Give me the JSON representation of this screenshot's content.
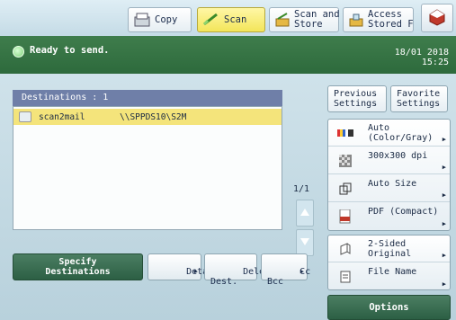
{
  "tabs": [
    {
      "label": "Copy",
      "icon": "copy-icon"
    },
    {
      "label": "Scan",
      "icon": "scan-icon"
    },
    {
      "label": "Scan and\nStore",
      "icon": "scan-store-icon"
    },
    {
      "label": "Access\nStored F",
      "icon": "access-stored-icon"
    }
  ],
  "home_icon": "home-icon",
  "status": {
    "message": "Ready to send.",
    "datetime": "18/01 2018\n15:25"
  },
  "destinations": {
    "header": "Destinations  : 1",
    "rows": [
      {
        "name": "scan2mail",
        "path": "\\\\SPPDS10\\S2M"
      }
    ],
    "page_indicator": "1/1"
  },
  "buttons": {
    "specify": "Specify\nDestinations",
    "details": "Details",
    "delete": "Delete\nDest.",
    "ccbcc": "Cc\nBcc"
  },
  "right": {
    "previous": "Previous\nSettings",
    "favorite": "Favorite\nSettings",
    "settings": [
      {
        "label": "Auto\n(Color/Gray)",
        "icon": "color-mode-icon"
      },
      {
        "label": "300x300 dpi",
        "icon": "resolution-icon"
      },
      {
        "label": "Auto Size",
        "icon": "scan-size-icon"
      },
      {
        "label": "PDF (Compact)",
        "icon": "pdf-icon"
      }
    ],
    "extra": [
      {
        "label": "2-Sided\nOriginal",
        "icon": "two-sided-icon"
      },
      {
        "label": "File Name",
        "icon": "file-name-icon"
      }
    ],
    "options": "Options"
  },
  "colors": {
    "status_green": "#2d6a3c",
    "active_tab": "#f3e55a",
    "selected_row": "#f4e47b"
  }
}
